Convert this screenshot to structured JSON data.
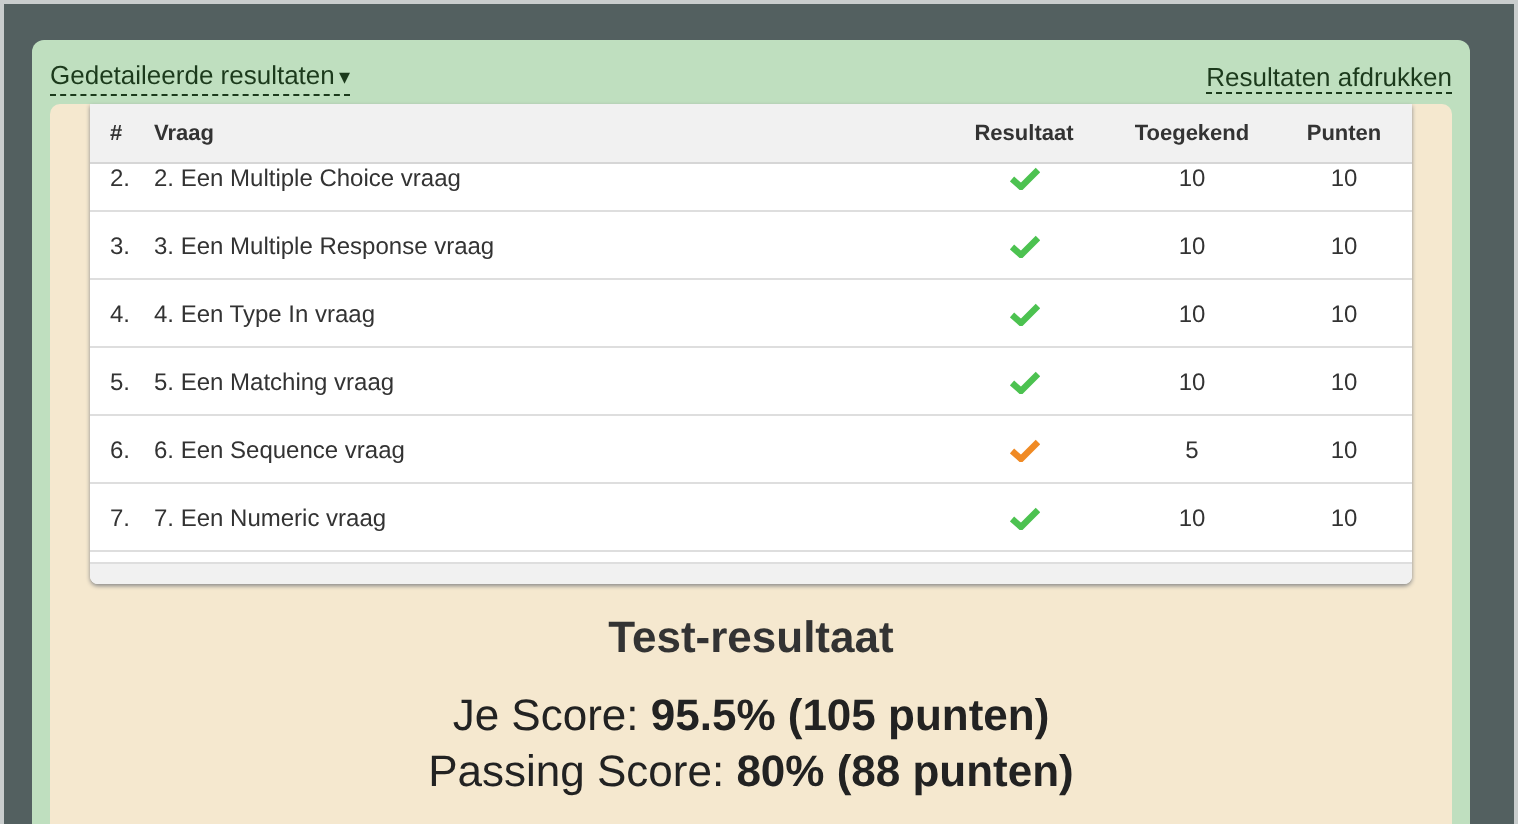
{
  "header": {
    "details_link": "Gedetaileerde resultaten",
    "caret": "▾",
    "print_link": "Resultaten afdrukken"
  },
  "table": {
    "columns": [
      "#",
      "Vraag",
      "Resultaat",
      "Toegekend",
      "Punten"
    ],
    "rows": [
      {
        "number": "2.",
        "question": "2. Een Multiple Choice vraag",
        "kind": "correct",
        "awarded": "10",
        "points": "10"
      },
      {
        "number": "3.",
        "question": "3. Een Multiple Response vraag",
        "kind": "correct",
        "awarded": "10",
        "points": "10"
      },
      {
        "number": "4.",
        "question": "4. Een Type In vraag",
        "kind": "correct",
        "awarded": "10",
        "points": "10"
      },
      {
        "number": "5.",
        "question": "5. Een Matching vraag",
        "kind": "correct",
        "awarded": "10",
        "points": "10"
      },
      {
        "number": "6.",
        "question": "6. Een Sequence vraag",
        "kind": "partial",
        "awarded": "5",
        "points": "10"
      },
      {
        "number": "7.",
        "question": "7. Een Numeric vraag",
        "kind": "correct",
        "awarded": "10",
        "points": "10"
      }
    ]
  },
  "summary": {
    "title": "Test-resultaat",
    "score": "Je Score: **95.5% (105 punten)**",
    "passing": "Passing Score: **80% (88 punten)**"
  }
}
